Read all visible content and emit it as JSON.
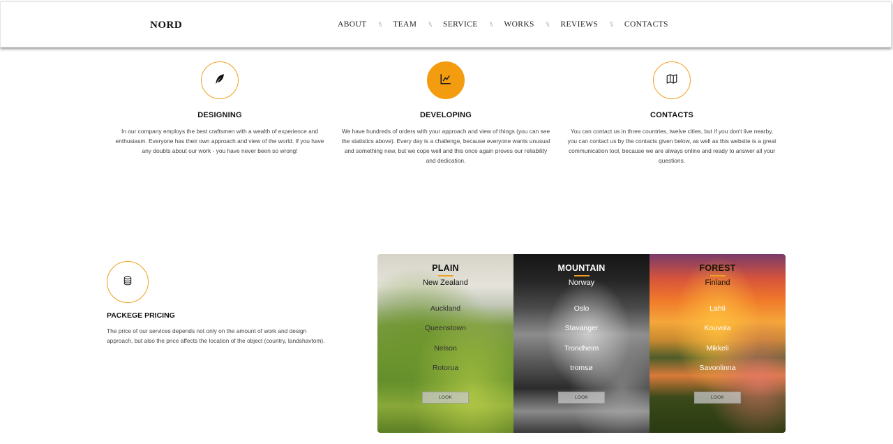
{
  "header": {
    "logo": "NORD",
    "nav": [
      {
        "label": "ABOUT"
      },
      {
        "label": "TEAM"
      },
      {
        "label": "SERVICE"
      },
      {
        "label": "WORKS"
      },
      {
        "label": "REVIEWS"
      },
      {
        "label": "CONTACTS"
      }
    ],
    "separator": "\\\\"
  },
  "features": [
    {
      "icon": "feather-icon",
      "title": "DESIGNING",
      "text": "In our company employs the best craftsmen with a wealth of experience and enthusiasm. Everyone has their own approach and view of the world. If you have any doubts about our work - you have never been so wrong!"
    },
    {
      "icon": "line-chart-icon",
      "title": "DEVELOPING",
      "text": "We have hundreds of orders with your approach and view of things (you can see the statistics above). Every day is a challenge, because everyone wants unusual and something new, but we cope well and this once again proves our reliability and dedication."
    },
    {
      "icon": "map-icon",
      "title": "CONTACTS",
      "text": "You can contact us in three countries, twelve cities, but if you don't live nearby, you can contact us by the contacts given below, as well as this website is a great communication tool, because we are always online and ready to answer all your questions."
    }
  ],
  "pricing": {
    "icon": "database-icon",
    "title": "PACKEGE PRICING",
    "text": "The price of our services depends not only on the amount of work and design approach, but also the price affects the location of the object (country, landshavtom)."
  },
  "cards": [
    {
      "title": "PLAIN",
      "country": "New Zealand",
      "cities": [
        "Auckland",
        "Queenstown",
        "Nelson",
        "Rotorua"
      ],
      "button": "LOOK"
    },
    {
      "title": "MOUNTAIN",
      "country": "Norway",
      "cities": [
        "Oslo",
        "Stavanger",
        "Trondheim",
        "tromsø"
      ],
      "button": "LOOK"
    },
    {
      "title": "FOREST",
      "country": "Finland",
      "cities": [
        "Lahti",
        "Kouvola",
        "Mikkeli",
        "Savonlinna"
      ],
      "button": "LOOK"
    }
  ],
  "colors": {
    "accent": "#f49c10",
    "text": "#222222",
    "background": "#ffffff"
  }
}
